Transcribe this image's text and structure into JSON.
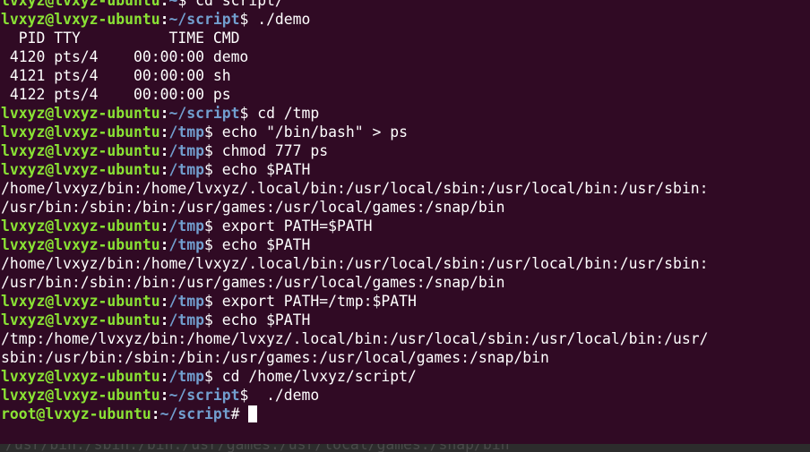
{
  "terminal": {
    "lines": [
      {
        "type": "prompt",
        "user": "lvxyz@lvxyz-ubuntu",
        "path": "~",
        "symbol": "$",
        "command": " cd script/"
      },
      {
        "type": "prompt",
        "user": "lvxyz@lvxyz-ubuntu",
        "path": "~/script",
        "symbol": "$",
        "command": " ./demo"
      },
      {
        "type": "output",
        "text": "  PID TTY          TIME CMD"
      },
      {
        "type": "output",
        "text": " 4120 pts/4    00:00:00 demo"
      },
      {
        "type": "output",
        "text": " 4121 pts/4    00:00:00 sh"
      },
      {
        "type": "output",
        "text": " 4122 pts/4    00:00:00 ps"
      },
      {
        "type": "prompt",
        "user": "lvxyz@lvxyz-ubuntu",
        "path": "~/script",
        "symbol": "$",
        "command": " cd /tmp"
      },
      {
        "type": "prompt",
        "user": "lvxyz@lvxyz-ubuntu",
        "path": "/tmp",
        "symbol": "$",
        "command": " echo \"/bin/bash\" > ps"
      },
      {
        "type": "prompt",
        "user": "lvxyz@lvxyz-ubuntu",
        "path": "/tmp",
        "symbol": "$",
        "command": " chmod 777 ps"
      },
      {
        "type": "prompt",
        "user": "lvxyz@lvxyz-ubuntu",
        "path": "/tmp",
        "symbol": "$",
        "command": " echo $PATH"
      },
      {
        "type": "output",
        "text": "/home/lvxyz/bin:/home/lvxyz/.local/bin:/usr/local/sbin:/usr/local/bin:/usr/sbin:"
      },
      {
        "type": "output",
        "text": "/usr/bin:/sbin:/bin:/usr/games:/usr/local/games:/snap/bin"
      },
      {
        "type": "prompt",
        "user": "lvxyz@lvxyz-ubuntu",
        "path": "/tmp",
        "symbol": "$",
        "command": " export PATH=$PATH"
      },
      {
        "type": "prompt",
        "user": "lvxyz@lvxyz-ubuntu",
        "path": "/tmp",
        "symbol": "$",
        "command": " echo $PATH"
      },
      {
        "type": "output",
        "text": "/home/lvxyz/bin:/home/lvxyz/.local/bin:/usr/local/sbin:/usr/local/bin:/usr/sbin:"
      },
      {
        "type": "output",
        "text": "/usr/bin:/sbin:/bin:/usr/games:/usr/local/games:/snap/bin"
      },
      {
        "type": "prompt",
        "user": "lvxyz@lvxyz-ubuntu",
        "path": "/tmp",
        "symbol": "$",
        "command": " export PATH=/tmp:$PATH"
      },
      {
        "type": "prompt",
        "user": "lvxyz@lvxyz-ubuntu",
        "path": "/tmp",
        "symbol": "$",
        "command": " echo $PATH"
      },
      {
        "type": "output",
        "text": "/tmp:/home/lvxyz/bin:/home/lvxyz/.local/bin:/usr/local/sbin:/usr/local/bin:/usr/"
      },
      {
        "type": "output",
        "text": "sbin:/usr/bin:/sbin:/bin:/usr/games:/usr/local/games:/snap/bin"
      },
      {
        "type": "prompt",
        "user": "lvxyz@lvxyz-ubuntu",
        "path": "/tmp",
        "symbol": "$",
        "command": " cd /home/lvxyz/script/"
      },
      {
        "type": "prompt",
        "user": "lvxyz@lvxyz-ubuntu",
        "path": "~/script",
        "symbol": "$",
        "command": "  ./demo"
      },
      {
        "type": "prompt",
        "user": "root@lvxyz-ubuntu",
        "path": "~/script",
        "symbol": "#",
        "command": " ",
        "cursor": true
      }
    ],
    "ghost_text": "/usr/bin:/sbin:/bin:/usr/games:/usr/local/games:/snap/bin"
  },
  "colors": {
    "background": "#300a24",
    "prompt_user": "#8ae234",
    "prompt_path": "#729fcf",
    "text": "#ffffff"
  }
}
